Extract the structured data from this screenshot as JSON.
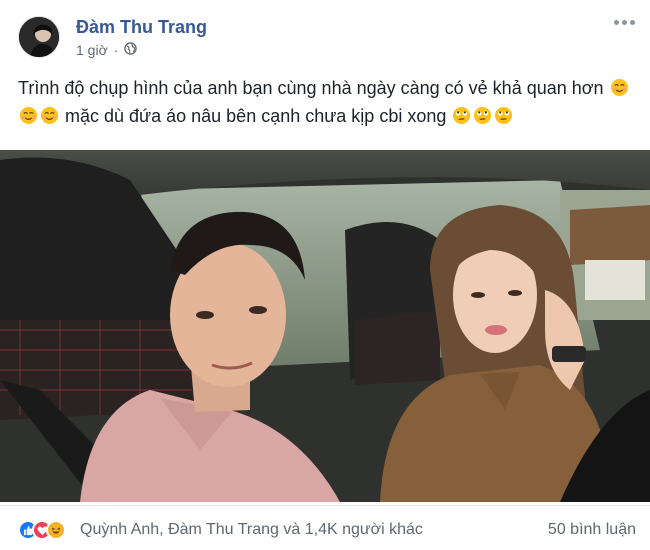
{
  "post": {
    "author": "Đàm Thu Trang",
    "timestamp": "1 giờ",
    "privacy_icon": "globe-icon",
    "text_line1": "Trình độ chụp hình của anh bạn cùng nhà ngày càng có vẻ khả quan hơn",
    "text_line2": "mặc dù đứa áo nâu bên cạnh chưa kịp cbi xong"
  },
  "footer": {
    "reaction_icons": [
      "like-icon",
      "love-icon",
      "haha-icon"
    ],
    "reaction_summary": "Quỳnh Anh, Đàm Thu Trang và 1,4K người khác",
    "comments": "50 bình luận"
  },
  "colors": {
    "author": "#385898",
    "meta": "#616770",
    "like": "#1877f2",
    "love": "#f33e58",
    "haha": "#f7b125"
  }
}
